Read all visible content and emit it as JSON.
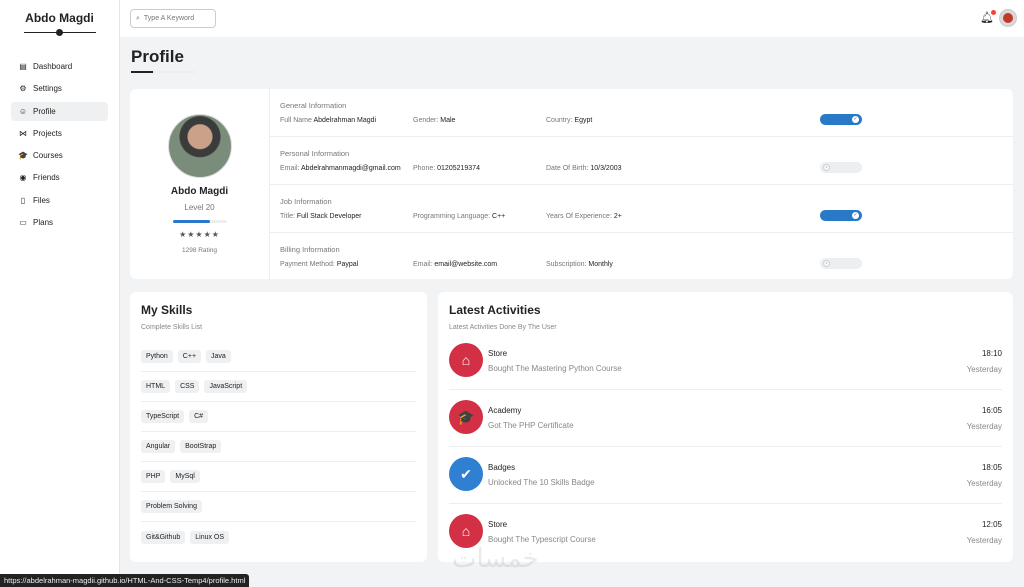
{
  "brand": {
    "name": "Abdo Magdi"
  },
  "sidebar": {
    "items": [
      {
        "label": "Dashboard",
        "icon": "chart-icon",
        "glyph": "▤"
      },
      {
        "label": "Settings",
        "icon": "gear-icon",
        "glyph": "⚙"
      },
      {
        "label": "Profile",
        "icon": "user-icon",
        "glyph": "☺"
      },
      {
        "label": "Projects",
        "icon": "diagram-icon",
        "glyph": "⋈"
      },
      {
        "label": "Courses",
        "icon": "graduation-cap-icon",
        "glyph": "🎓"
      },
      {
        "label": "Friends",
        "icon": "circle-user-icon",
        "glyph": "◉"
      },
      {
        "label": "Files",
        "icon": "file-icon",
        "glyph": "▯"
      },
      {
        "label": "Plans",
        "icon": "card-icon",
        "glyph": "▭"
      }
    ],
    "active_index": 2
  },
  "header": {
    "search_placeholder": "Type A Keyword"
  },
  "page": {
    "title": "Profile"
  },
  "profile": {
    "name": "Abdo Magdi",
    "level": "Level 20",
    "level_progress": 0.7,
    "stars": "★★★★★",
    "rating": "1298 Rating"
  },
  "sections": [
    {
      "title": "General Information",
      "toggle_on": true,
      "fields": [
        {
          "label": "Full Name",
          "value": "Abdelrahman Magdi"
        },
        {
          "label": "Gender:",
          "value": "Male"
        },
        {
          "label": "Country:",
          "value": "Egypt"
        }
      ]
    },
    {
      "title": "Personal Information",
      "toggle_on": false,
      "fields": [
        {
          "label": "Email:",
          "value": "Abdelrahmanmagdi@gmail.com"
        },
        {
          "label": "Phone:",
          "value": "01205219374"
        },
        {
          "label": "Date Of Birth:",
          "value": "10/3/2003"
        }
      ]
    },
    {
      "title": "Job Information",
      "toggle_on": true,
      "fields": [
        {
          "label": "Title:",
          "value": "Full Stack Developer"
        },
        {
          "label": "Programming Language:",
          "value": "C++"
        },
        {
          "label": "Years Of Experience:",
          "value": "2+"
        }
      ]
    },
    {
      "title": "Billing Information",
      "toggle_on": false,
      "fields": [
        {
          "label": "Payment Method:",
          "value": "Paypal"
        },
        {
          "label": "Email:",
          "value": "email@website.com"
        },
        {
          "label": "Subscription:",
          "value": "Monthly"
        }
      ]
    }
  ],
  "skills": {
    "title": "My Skills",
    "subtitle": "Complete Skills List",
    "rows": [
      [
        "Python",
        "C++",
        "Java"
      ],
      [
        "HTML",
        "CSS",
        "JavaScript"
      ],
      [
        "TypeScript",
        "C#"
      ],
      [
        "Angular",
        "BootStrap"
      ],
      [
        "PHP",
        "MySql"
      ],
      [
        "Problem Solving"
      ],
      [
        "Git&Github",
        "Linux OS"
      ]
    ]
  },
  "activities": {
    "title": "Latest Activities",
    "subtitle": "Latest Activities Done By The User",
    "items": [
      {
        "name": "Store",
        "desc": "Bought The Mastering Python Course",
        "time": "18:10",
        "day": "Yesterday",
        "icon": "store-icon",
        "glyph": "⌂",
        "color": "#d32f45"
      },
      {
        "name": "Academy",
        "desc": "Got The PHP Certificate",
        "time": "16:05",
        "day": "Yesterday",
        "icon": "graduation-cap-icon",
        "glyph": "🎓",
        "color": "#d32f45"
      },
      {
        "name": "Badges",
        "desc": "Unlocked The 10 Skills Badge",
        "time": "18:05",
        "day": "Yesterday",
        "icon": "badge-check-icon",
        "glyph": "✔",
        "color": "#2f7fd3"
      },
      {
        "name": "Store",
        "desc": "Bought The Typescript Course",
        "time": "12:05",
        "day": "Yesterday",
        "icon": "store-icon",
        "glyph": "⌂",
        "color": "#d32f45"
      }
    ]
  },
  "statusbar": {
    "url": "https://abdelrahman-magdii.github.io/HTML-And-CSS-Temp4/profile.html"
  },
  "watermark": {
    "text": "خمسات"
  }
}
